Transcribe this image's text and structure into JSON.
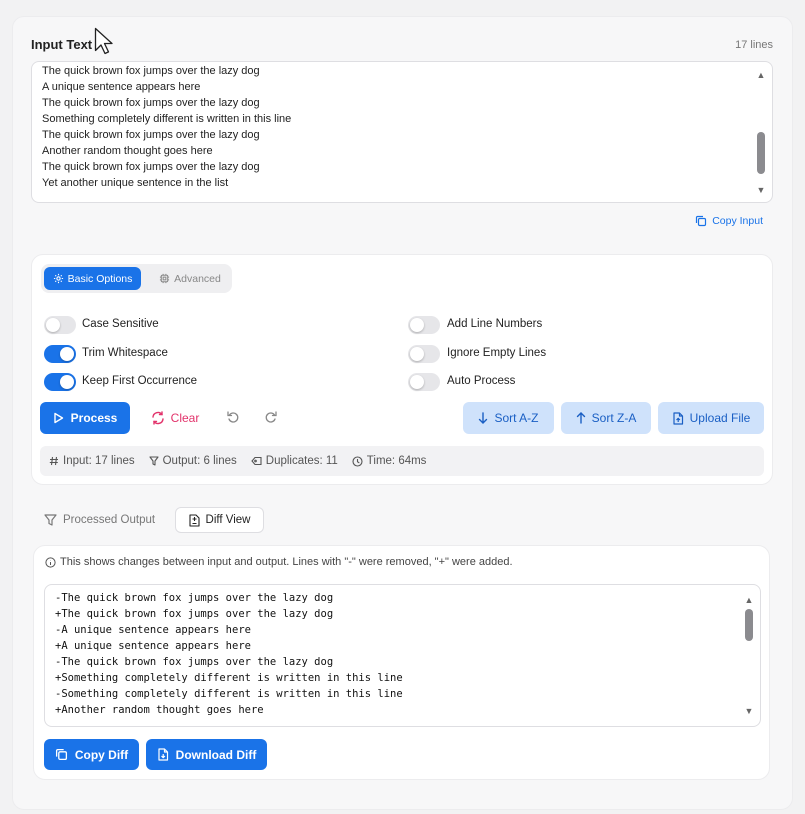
{
  "input": {
    "title": "Input Text",
    "line_count": "17 lines",
    "lines": [
      "The quick brown fox jumps over the lazy dog",
      "A unique sentence appears here",
      "The quick brown fox jumps over the lazy dog",
      "Something completely different is written in this line",
      "The quick brown fox jumps over the lazy dog",
      "Another random thought goes here",
      "The quick brown fox jumps over the lazy dog",
      "Yet another unique sentence in the list"
    ],
    "copy_label": "Copy Input"
  },
  "options": {
    "tabs": [
      {
        "label": "Basic Options",
        "icon": "gear-icon",
        "active": true
      },
      {
        "label": "Advanced",
        "icon": "cpu-icon",
        "active": false
      }
    ],
    "toggles_left": [
      {
        "label": "Case Sensitive",
        "on": false
      },
      {
        "label": "Trim Whitespace",
        "on": true
      },
      {
        "label": "Keep First Occurrence",
        "on": true
      }
    ],
    "toggles_right": [
      {
        "label": "Add Line Numbers",
        "on": false
      },
      {
        "label": "Ignore Empty Lines",
        "on": false
      },
      {
        "label": "Auto Process",
        "on": false
      }
    ],
    "actions": {
      "process": "Process",
      "clear": "Clear",
      "sort_az": "Sort A-Z",
      "sort_za": "Sort Z-A",
      "upload": "Upload File"
    },
    "stats": {
      "input": "Input: 17 lines",
      "output": "Output: 6 lines",
      "duplicates": "Duplicates: 11",
      "time": "Time: 64ms"
    }
  },
  "output": {
    "tabs": [
      {
        "label": "Processed Output",
        "active": false
      },
      {
        "label": "Diff View",
        "active": true
      }
    ],
    "info": "This shows changes between input and output. Lines with \"-\" were removed, \"+\" were added.",
    "diff_lines": [
      "-The quick brown fox jumps over the lazy dog",
      "+The quick brown fox jumps over the lazy dog",
      "-A unique sentence appears here",
      "+A unique sentence appears here",
      "-The quick brown fox jumps over the lazy dog",
      "+Something completely different is written in this line",
      "-Something completely different is written in this line",
      "+Another random thought goes here"
    ],
    "copy_diff": "Copy Diff",
    "download_diff": "Download Diff"
  },
  "colors": {
    "accent": "#1a73e8",
    "danger": "#e2336b",
    "light_accent": "#cfe2fb"
  }
}
